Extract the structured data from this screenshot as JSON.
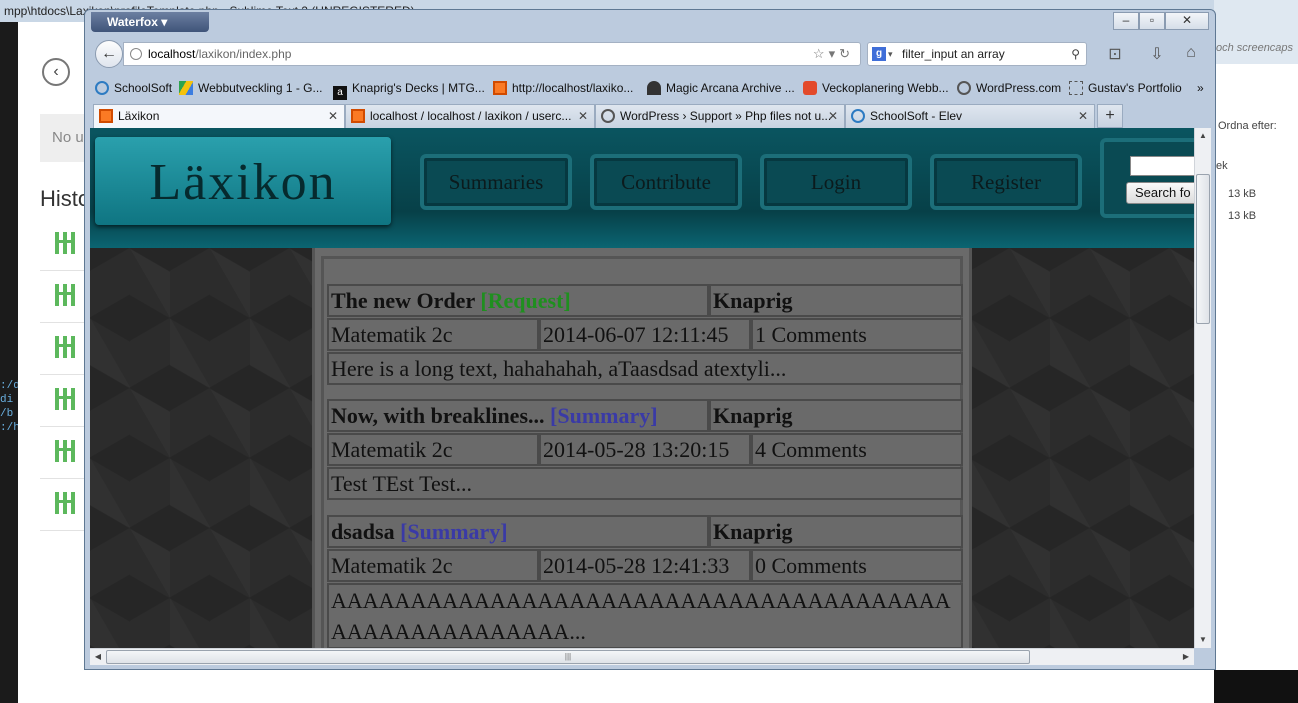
{
  "background": {
    "editor_title": "mpp\\htdocs\\Laxikon\\profileTemplate.php - Sublime Text 2 (UNREGISTERED)",
    "left_page": {
      "notice": "No u",
      "history_label": "Histo"
    },
    "explorer": {
      "search_text": "och screencaps",
      "sort_label": "Ordna efter:",
      "type_label": "ek",
      "sizes": [
        "13 kB",
        "13 kB"
      ]
    }
  },
  "browser": {
    "app_name": "Waterfox",
    "url_host": "localhost",
    "url_path": "/laxikon/index.php",
    "search_value": "filter_input an array",
    "bookmarks": [
      {
        "label": "SchoolSoft",
        "icon": "schoolsoft-icon"
      },
      {
        "label": "Webbutveckling 1 - G...",
        "icon": "drive-icon"
      },
      {
        "label": "Knaprig's Decks | MTG...",
        "icon": "mtg-icon"
      },
      {
        "label": "http://localhost/laxiko...",
        "icon": "xampp-icon"
      },
      {
        "label": "Magic Arcana Archive ...",
        "icon": "magic-icon"
      },
      {
        "label": "Veckoplanering Webb...",
        "icon": "page-icon"
      },
      {
        "label": "WordPress.com",
        "icon": "wordpress-icon"
      },
      {
        "label": "Gustav's Portfolio",
        "icon": "blank-page-icon"
      }
    ],
    "tabs": [
      {
        "label": "Läxikon",
        "icon": "xampp-icon",
        "active": true
      },
      {
        "label": "localhost / localhost / laxikon / userc...",
        "icon": "xampp-icon",
        "active": false
      },
      {
        "label": "WordPress › Support » Php files not u...",
        "icon": "wordpress-icon",
        "active": false
      },
      {
        "label": "SchoolSoft - Elev",
        "icon": "schoolsoft-icon",
        "active": false
      }
    ]
  },
  "site": {
    "logo": "Läxikon",
    "nav": [
      "Summaries",
      "Contribute",
      "Login",
      "Register"
    ],
    "search_button": "Search fo",
    "accent": "#0a4a53",
    "posts": [
      {
        "title": "The new Order",
        "tag": "[Request]",
        "tag_type": "request",
        "author": "Knaprig",
        "subject": "Matematik 2c",
        "date": "2014-06-07 12:11:45",
        "comments": "1 Comments",
        "excerpt": "Here is a long text, hahahahah, aTaasdsad atextyli..."
      },
      {
        "title": "Now, with breaklines...",
        "tag": "[Summary]",
        "tag_type": "summary",
        "author": "Knaprig",
        "subject": "Matematik 2c",
        "date": "2014-05-28 13:20:15",
        "comments": "4 Comments",
        "excerpt": "Test TEst  Test..."
      },
      {
        "title": "dsadsa",
        "tag": "[Summary]",
        "tag_type": "summary",
        "author": "Knaprig",
        "subject": "Matematik 2c",
        "date": "2014-05-28 12:41:33",
        "comments": "0 Comments",
        "excerpt": "AAAAAAAAAAAAAAAAAAAAAAAAAAAAAAAAAAAAAAAAAAAAAAAAAAAAAA..."
      }
    ]
  }
}
